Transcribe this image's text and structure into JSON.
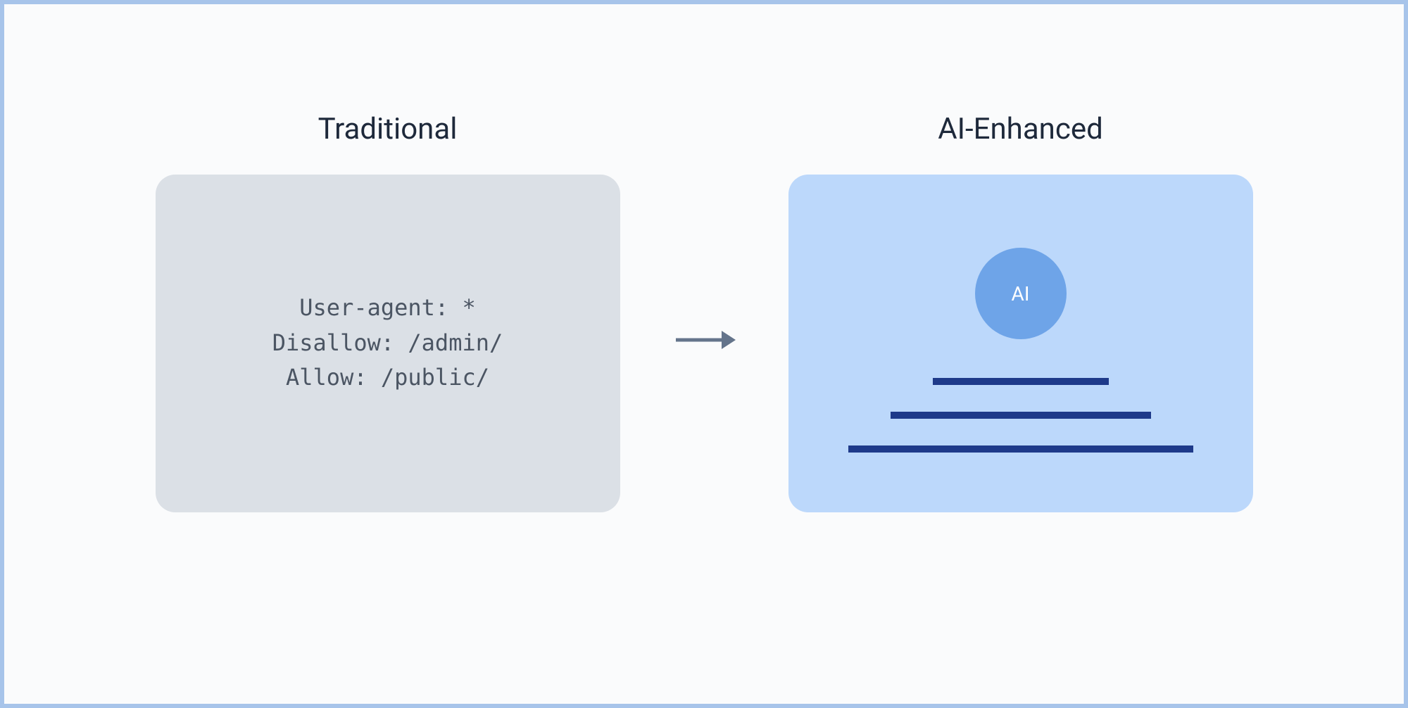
{
  "left": {
    "title": "Traditional",
    "code": "User-agent: *\nDisallow: /admin/\nAllow: /public/"
  },
  "right": {
    "title": "AI-Enhanced",
    "circle_label": "AI"
  }
}
